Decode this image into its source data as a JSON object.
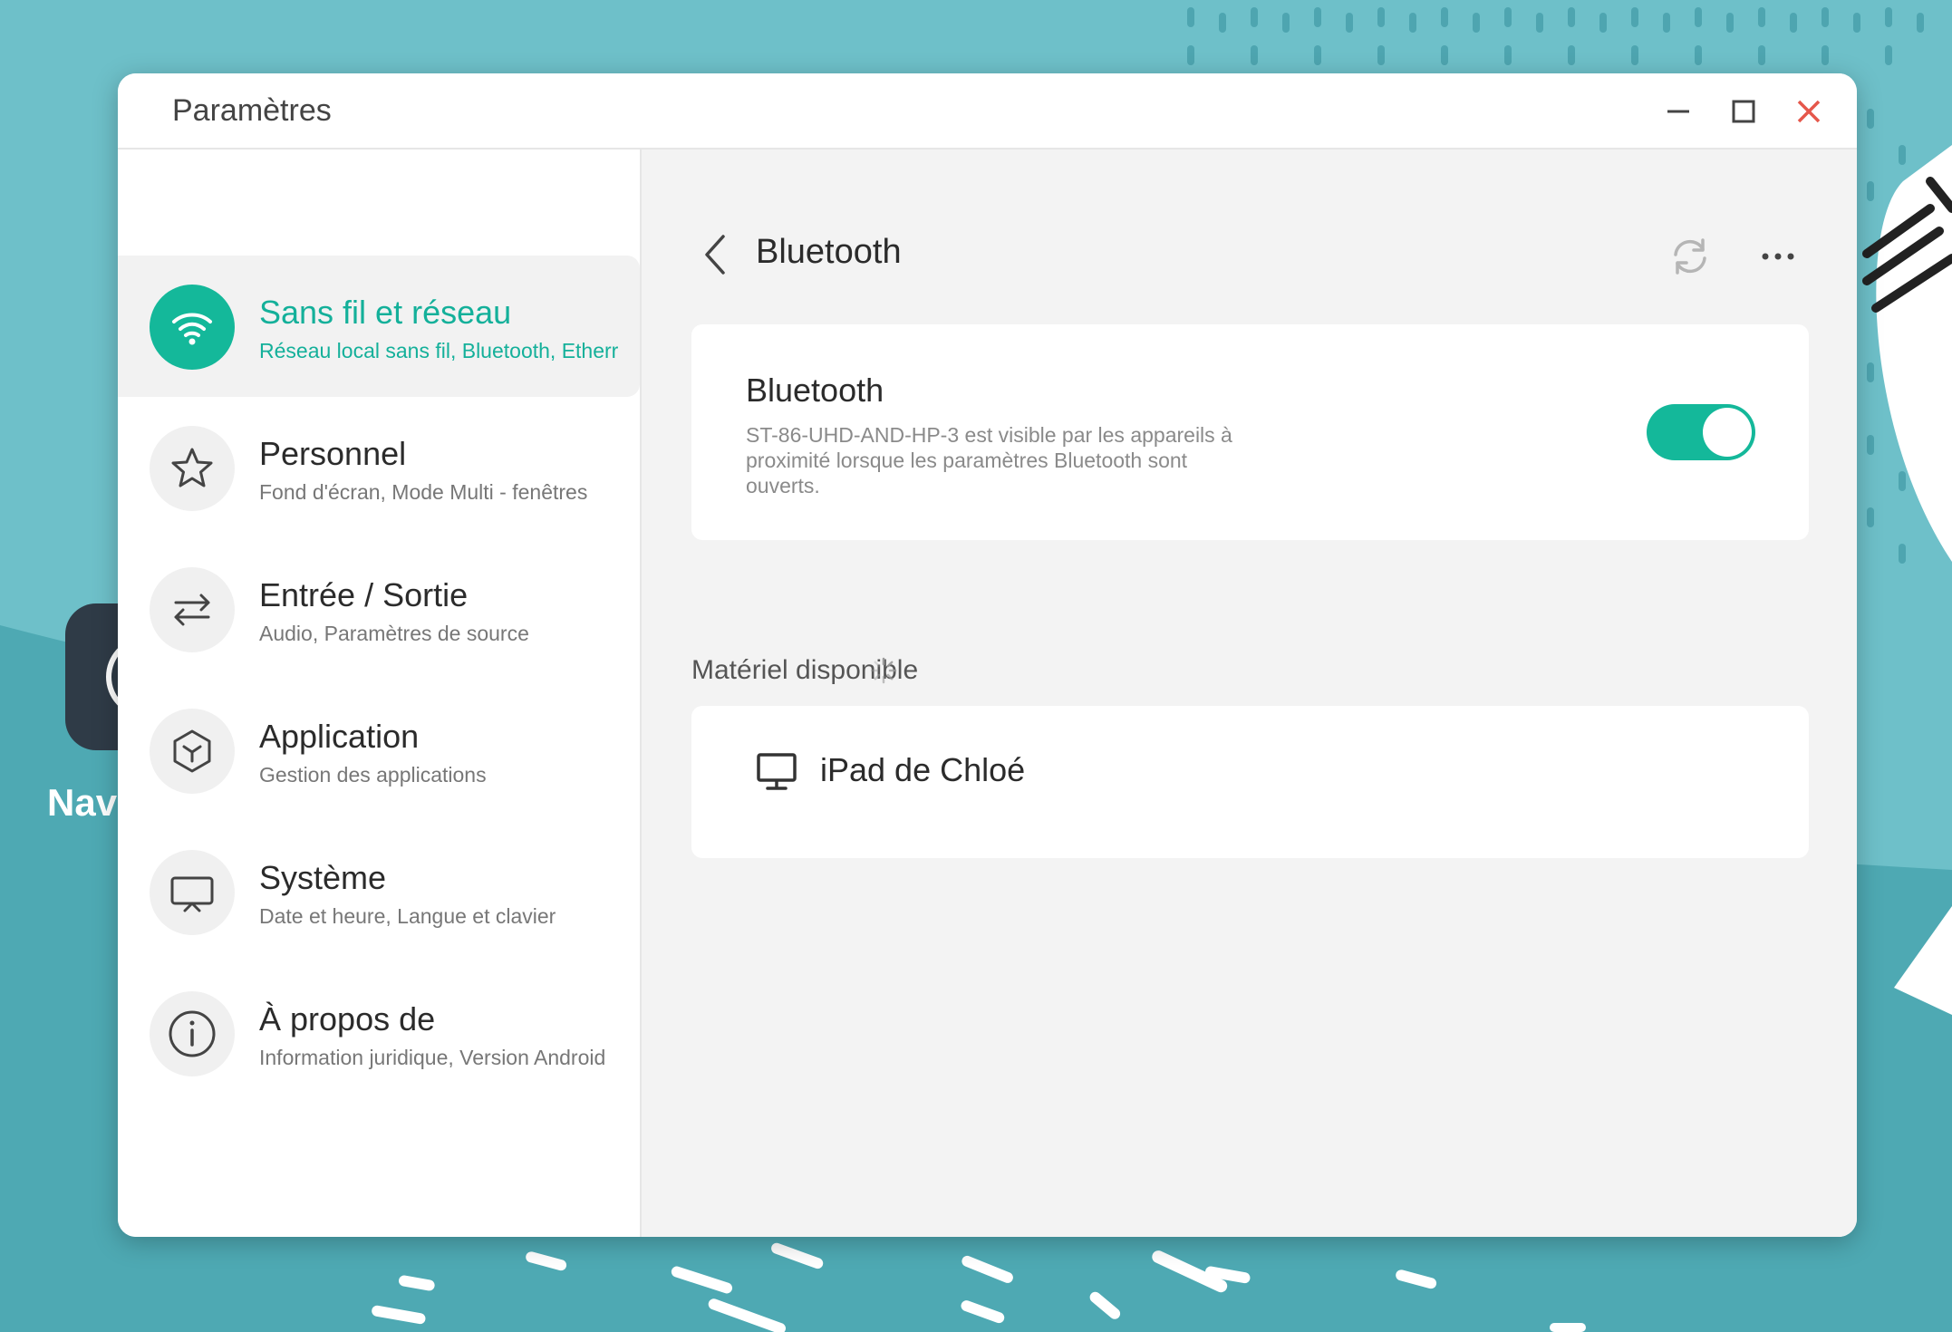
{
  "window": {
    "title": "Paramètres"
  },
  "desktop": {
    "app_label": "Navi"
  },
  "sidebar": {
    "items": [
      {
        "title": "Sans fil et réseau",
        "subtitle": "Réseau local sans fil, Bluetooth, Etherr",
        "icon": "wifi-icon",
        "active": true
      },
      {
        "title": "Personnel",
        "subtitle": "Fond d'écran, Mode Multi - fenêtres",
        "icon": "star-icon",
        "active": false
      },
      {
        "title": "Entrée / Sortie",
        "subtitle": "Audio, Paramètres de source",
        "icon": "swap-arrows-icon",
        "active": false
      },
      {
        "title": "Application",
        "subtitle": "Gestion des applications",
        "icon": "cube-icon",
        "active": false
      },
      {
        "title": "Système",
        "subtitle": "Date et heure, Langue et clavier",
        "icon": "presentation-screen-icon",
        "active": false
      },
      {
        "title": "À propos de",
        "subtitle": "Information juridique, Version Android",
        "icon": "info-icon",
        "active": false
      }
    ]
  },
  "content": {
    "title": "Bluetooth",
    "bluetooth_card": {
      "title": "Bluetooth",
      "description": "ST-86-UHD-AND-HP-3 est visible par les appareils à proximité lorsque les paramètres Bluetooth sont ouverts.",
      "enabled": true
    },
    "available_label": "Matériel disponible",
    "devices": [
      {
        "name": "iPad de Chloé",
        "icon": "monitor-icon"
      }
    ]
  },
  "colors": {
    "accent": "#14b89a",
    "close": "#e5574b",
    "background": "#5fb3bd"
  }
}
